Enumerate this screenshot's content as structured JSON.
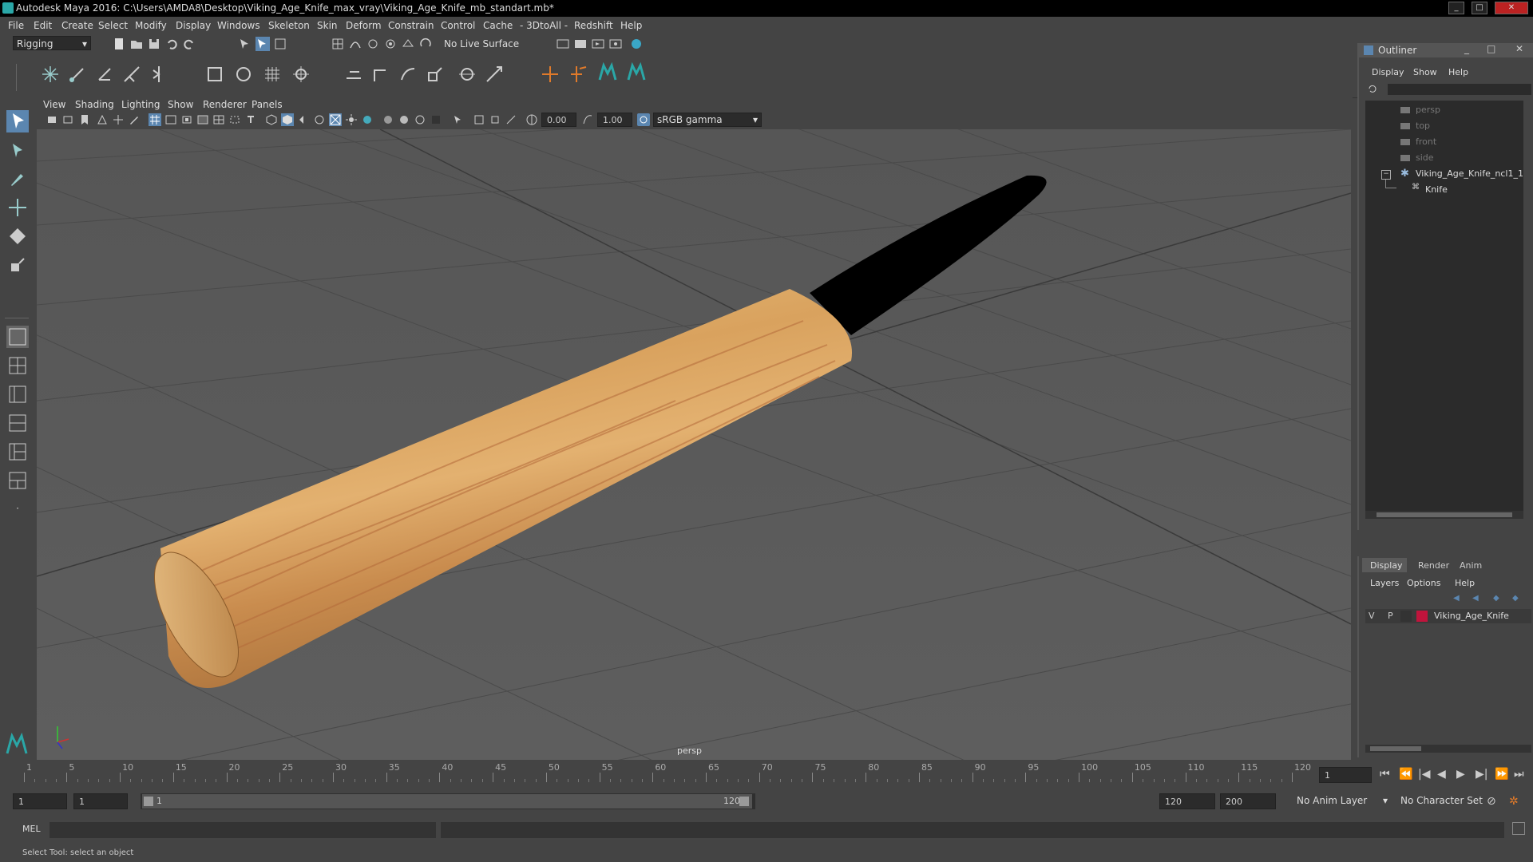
{
  "window": {
    "title": "Autodesk Maya 2016: C:\\Users\\AMDA8\\Desktop\\Viking_Age_Knife_max_vray\\Viking_Age_Knife_mb_standart.mb*"
  },
  "menubar": {
    "items": [
      "File",
      "Edit",
      "Create",
      "Select",
      "Modify",
      "Display",
      "Windows",
      "Skeleton",
      "Skin",
      "Deform",
      "Constrain",
      "Control",
      "Cache",
      "- 3DtoAll -",
      "Redshift",
      "Help"
    ]
  },
  "shelf": {
    "mode": "Rigging",
    "live_surface": "No Live Surface"
  },
  "viewport": {
    "menu": [
      "View",
      "Shading",
      "Lighting",
      "Show",
      "Renderer",
      "Panels"
    ],
    "exposure": "0.00",
    "gamma": "1.00",
    "color_space": "sRGB gamma",
    "camera_label": "persp"
  },
  "outliner": {
    "title": "Outliner",
    "menu": [
      "Display",
      "Show",
      "Help"
    ],
    "items": [
      {
        "label": "persp",
        "dim": true
      },
      {
        "label": "top",
        "dim": true
      },
      {
        "label": "front",
        "dim": true
      },
      {
        "label": "side",
        "dim": true
      },
      {
        "label": "Viking_Age_Knife_ncl1_1",
        "dim": false
      },
      {
        "label": "Knife",
        "dim": false
      }
    ]
  },
  "layers": {
    "tabs": [
      "Display",
      "Render",
      "Anim"
    ],
    "menu": [
      "Layers",
      "Options",
      "Help"
    ],
    "row": {
      "v": "V",
      "p": "P",
      "name": "Viking_Age_Knife",
      "color": "#c0143c"
    }
  },
  "timeline": {
    "ticks": [
      "1",
      "5",
      "10",
      "15",
      "20",
      "25",
      "30",
      "35",
      "40",
      "45",
      "50",
      "55",
      "60",
      "65",
      "70",
      "75",
      "80",
      "85",
      "90",
      "95",
      "100",
      "105",
      "110",
      "115",
      "120"
    ],
    "current_frame": "1"
  },
  "range": {
    "start": "1",
    "playback_start": "1",
    "slider_start": "1",
    "slider_end": "120",
    "playback_end": "120",
    "end": "200",
    "anim_layer": "No Anim Layer",
    "character_set": "No Character Set"
  },
  "cmd": {
    "label": "MEL"
  },
  "help": {
    "text": "Select Tool: select an object"
  }
}
